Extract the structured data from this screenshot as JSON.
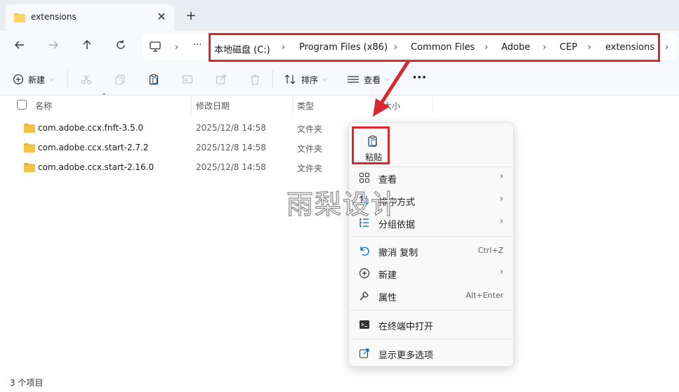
{
  "tab": {
    "title": "extensions",
    "close": "✕",
    "new": "+"
  },
  "address": {
    "crumbs": [
      "本地磁盘 (C:)",
      "Program Files (x86)",
      "Common Files",
      "Adobe",
      "CEP",
      "extensions"
    ],
    "ellipsis": "···"
  },
  "toolbar": {
    "new_label": "新建",
    "sort_label": "排序",
    "view_label": "查看",
    "more": "···"
  },
  "columns": {
    "name": "名称",
    "date": "修改日期",
    "type": "类型",
    "size": "大小"
  },
  "files": [
    {
      "name": "com.adobe.ccx.fnft-3.5.0",
      "date": "2025/12/8 14:58",
      "type": "文件夹"
    },
    {
      "name": "com.adobe.ccx.start-2.7.2",
      "date": "2025/12/8 14:58",
      "type": "文件夹"
    },
    {
      "name": "com.adobe.ccx.start-2.16.0",
      "date": "2025/12/8 14:58",
      "type": "文件夹"
    }
  ],
  "status": {
    "count": "3 个项目"
  },
  "watermark": "雨梨设计",
  "context_menu": {
    "paste": "粘贴",
    "view": "查看",
    "sort": "排序方式",
    "group": "分组依据",
    "undo": "撤消 复制",
    "undo_shortcut": "Ctrl+Z",
    "new": "新建",
    "properties": "属性",
    "properties_shortcut": "Alt+Enter",
    "terminal": "在终端中打开",
    "more_options": "显示更多选项"
  },
  "colors": {
    "accent": "#0067c0",
    "highlight_red": "#d7282f",
    "folder": "#f4c445"
  }
}
